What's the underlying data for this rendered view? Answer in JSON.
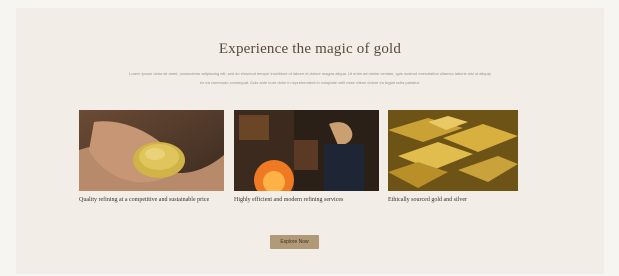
{
  "section": {
    "title": "Experience the magic of gold",
    "intro": "Lorem ipsum dolor sit amet, consectetur adipiscing elit, sed do eiusmod tempor incididunt ut labore et dolore magna aliqua. Ut enim ad minim veniam, quis nostrud exercitation ullamco laboris nisi ut aliquip ex ea commodo consequat. Duis aute irure dolor in reprehenderit in voluptate velit esse cillum dolore eu fugiat nulla pariatur."
  },
  "cards": [
    {
      "caption": "Quality refining at a competitive and sustainable price",
      "image": "hands-holding-gold-grains"
    },
    {
      "caption": "Highly efficient and modern refining services",
      "image": "gold-refinery-worker"
    },
    {
      "caption": "Ethically sourced gold and silver",
      "image": "gold-bars-stack"
    }
  ],
  "cta": {
    "label": "Explore Now"
  },
  "colors": {
    "background": "#f7f5f1",
    "panel": "#f2ede6",
    "accent": "#b09a78"
  }
}
